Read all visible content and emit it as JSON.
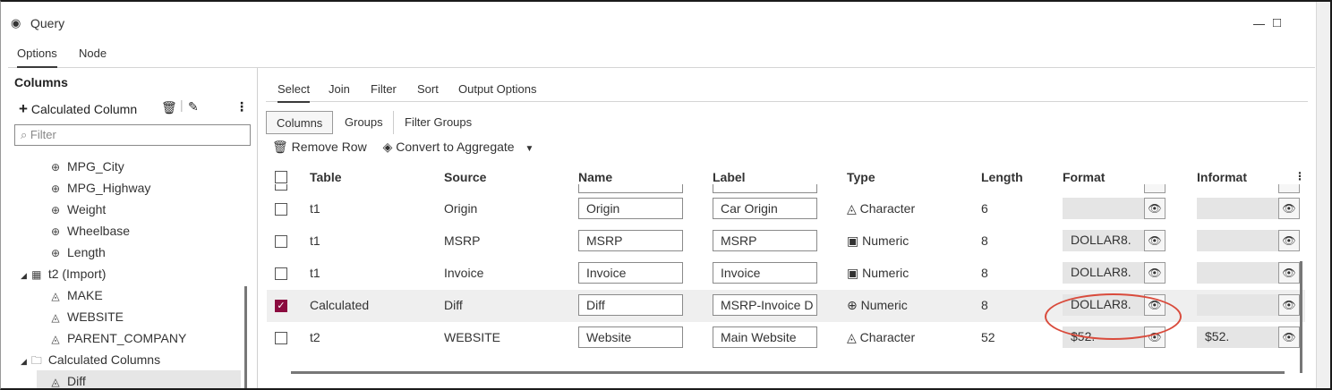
{
  "window": {
    "title": "Query",
    "icon": "eye-icon",
    "controls": [
      "minimize-icon",
      "maximize-icon"
    ]
  },
  "top_tabs": [
    {
      "label": "Options",
      "active": true
    },
    {
      "label": "Node",
      "active": false
    }
  ],
  "left_panel": {
    "heading": "Columns",
    "add_label": "Calculated Column",
    "filter_placeholder": "Filter",
    "tree": [
      {
        "label": "MPG_City",
        "icon": "numeric-icon"
      },
      {
        "label": "MPG_Highway",
        "icon": "numeric-icon"
      },
      {
        "label": "Weight",
        "icon": "numeric-icon"
      },
      {
        "label": "Wheelbase",
        "icon": "numeric-icon"
      },
      {
        "label": "Length",
        "icon": "numeric-icon"
      },
      {
        "label": "t2 (Import)",
        "icon": "table-icon"
      },
      {
        "label": "MAKE",
        "icon": "character-icon"
      },
      {
        "label": "WEBSITE",
        "icon": "character-icon"
      },
      {
        "label": "PARENT_COMPANY",
        "icon": "character-icon"
      },
      {
        "label": "Calculated Columns",
        "icon": "folder-icon"
      },
      {
        "label": "Diff",
        "icon": "character-icon",
        "selected": true
      }
    ]
  },
  "sub_tabs": [
    {
      "label": "Select",
      "active": true
    },
    {
      "label": "Join",
      "active": false
    },
    {
      "label": "Filter",
      "active": false
    },
    {
      "label": "Sort",
      "active": false
    },
    {
      "label": "Output Options",
      "active": false
    }
  ],
  "seg_tabs": [
    {
      "label": "Columns",
      "active": true
    },
    {
      "label": "Groups",
      "active": false
    },
    {
      "label": "Filter Groups",
      "active": false
    }
  ],
  "actions": {
    "remove_row": "Remove Row",
    "convert": "Convert to Aggregate"
  },
  "grid": {
    "headers": [
      "Table",
      "Source",
      "Name",
      "Label",
      "Type",
      "Length",
      "Format",
      "Informat"
    ],
    "rows": [
      {
        "table": "t1",
        "source": "Origin",
        "name": "Origin",
        "label": "Car Origin",
        "type": "Character",
        "type_icon": "character-icon",
        "length": "6",
        "format": "",
        "informat": "",
        "checked": false
      },
      {
        "table": "t1",
        "source": "MSRP",
        "name": "MSRP",
        "label": "MSRP",
        "type": "Numeric",
        "type_icon": "numeric-calc-icon",
        "length": "8",
        "format": "DOLLAR8.",
        "informat": "",
        "checked": false
      },
      {
        "table": "t1",
        "source": "Invoice",
        "name": "Invoice",
        "label": "Invoice",
        "type": "Numeric",
        "type_icon": "numeric-calc-icon",
        "length": "8",
        "format": "DOLLAR8.",
        "informat": "",
        "checked": false
      },
      {
        "table": "Calculated",
        "source": "Diff",
        "name": "Diff",
        "label": "MSRP-Invoice D",
        "type": "Numeric",
        "type_icon": "numeric-icon",
        "length": "8",
        "format": "DOLLAR8.",
        "informat": "",
        "checked": true
      },
      {
        "table": "t2",
        "source": "WEBSITE",
        "name": "Website",
        "label": "Main Website",
        "type": "Character",
        "type_icon": "character-icon",
        "length": "52",
        "format": "$52.",
        "informat": "$52.",
        "checked": false
      }
    ]
  },
  "colors": {
    "checkbox_checked": "#8b0b3f",
    "callout": "#d94b3c",
    "selected_row": "#efefef"
  }
}
